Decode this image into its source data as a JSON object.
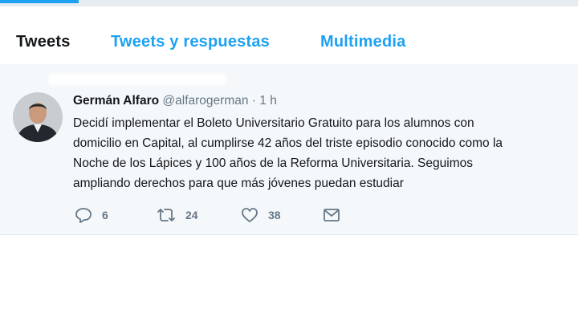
{
  "tabs": [
    {
      "label": "Tweets"
    },
    {
      "label": "Tweets y respuestas"
    },
    {
      "label": "Multimedia"
    }
  ],
  "tweet": {
    "author_name": "Germán Alfaro",
    "handle": "@alfarogerman",
    "separator": "·",
    "time": "1 h",
    "text": "Decidí implementar el Boleto Universitario Gratuito para los alumnos con\ndomicilio en Capital, al cumplirse 42 años del triste episodio conocido como la\nNoche de los Lápices y 100 años de la Reforma Universitaria. Seguimos\nampliando derechos para que más jóvenes puedan estudiar",
    "actions": {
      "replies": "6",
      "retweets": "24",
      "likes": "38"
    }
  },
  "icons": [
    "reply-icon",
    "retweet-icon",
    "like-icon",
    "direct-message-icon"
  ],
  "colors": {
    "accent": "#1da1f2",
    "text": "#14171a",
    "muted": "#657786",
    "feed_background": "#f5f8fa"
  }
}
